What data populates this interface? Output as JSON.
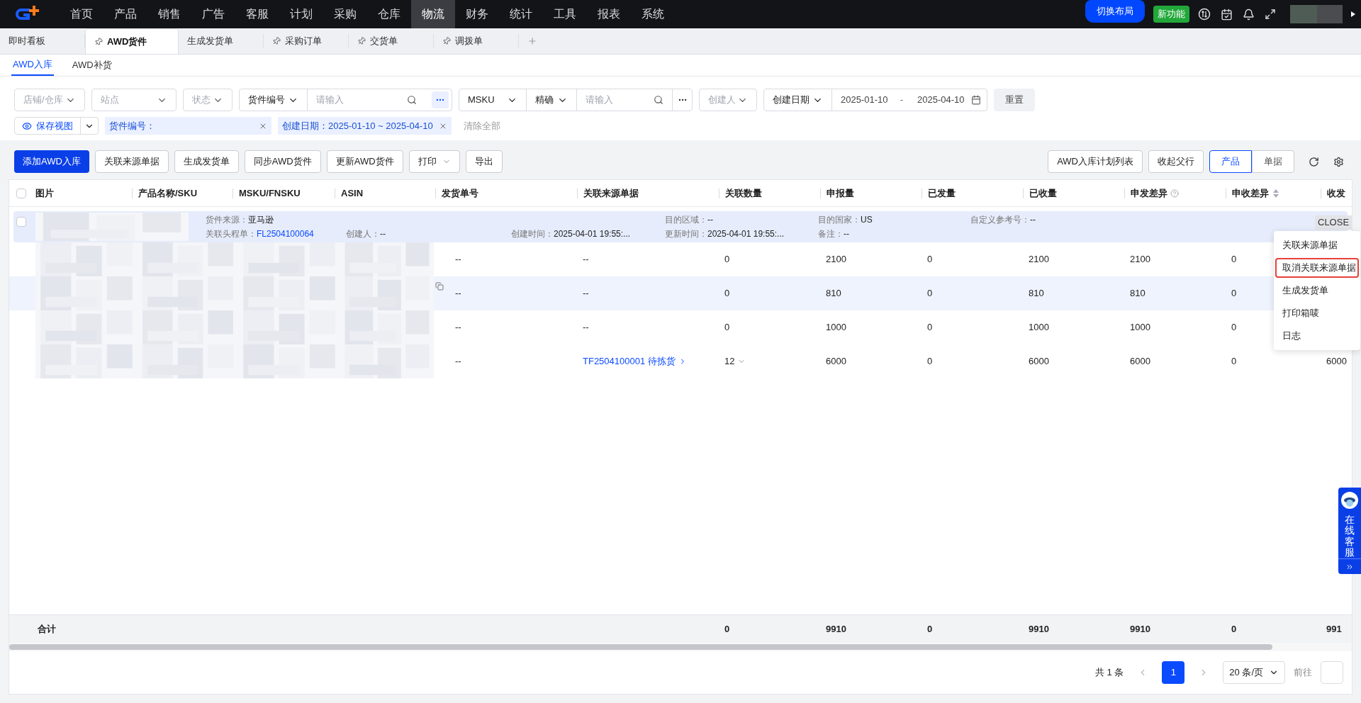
{
  "nav": {
    "items": [
      {
        "label": "首页",
        "selected": false
      },
      {
        "label": "产品",
        "selected": false
      },
      {
        "label": "销售",
        "selected": false
      },
      {
        "label": "广告",
        "selected": false
      },
      {
        "label": "客服",
        "selected": false
      },
      {
        "label": "计划",
        "selected": false
      },
      {
        "label": "采购",
        "selected": false
      },
      {
        "label": "仓库",
        "selected": false
      },
      {
        "label": "物流",
        "selected": true
      },
      {
        "label": "财务",
        "selected": false
      },
      {
        "label": "统计",
        "selected": false
      },
      {
        "label": "工具",
        "selected": false
      },
      {
        "label": "报表",
        "selected": false
      },
      {
        "label": "系统",
        "selected": false
      }
    ],
    "switch_layout": "切换布局",
    "new_feature": "新功能"
  },
  "page_tabs": [
    {
      "label": "即时看板",
      "pinned": false,
      "selected": false
    },
    {
      "label": "AWD货件",
      "pinned": true,
      "selected": true
    },
    {
      "label": "生成发货单",
      "pinned": false,
      "selected": false
    },
    {
      "label": "采购订单",
      "pinned": true,
      "selected": false
    },
    {
      "label": "交货单",
      "pinned": true,
      "selected": false
    },
    {
      "label": "调拨单",
      "pinned": true,
      "selected": false
    }
  ],
  "sub_tabs": [
    {
      "label": "AWD入库",
      "selected": true
    },
    {
      "label": "AWD补货",
      "selected": false
    }
  ],
  "filters": {
    "shop": {
      "placeholder": "店铺/仓库"
    },
    "site": {
      "placeholder": "站点"
    },
    "status": {
      "placeholder": "状态"
    },
    "shipment_no": {
      "field": "货件编号",
      "placeholder": "请输入"
    },
    "msku": {
      "field": "MSKU",
      "match": "精确",
      "placeholder": "请输入"
    },
    "creator": {
      "placeholder": "创建人"
    },
    "date": {
      "field": "创建日期",
      "start": "2025-01-10",
      "separator": "-",
      "end": "2025-04-10"
    },
    "reset": "重置"
  },
  "view": {
    "save_view": "保存视图",
    "tags": [
      {
        "label": "货件编号："
      },
      {
        "label": "创建日期：2025-01-10 ~ 2025-04-10"
      }
    ],
    "clear_all": "清除全部"
  },
  "toolbar": {
    "left": [
      {
        "label": "添加AWD入库",
        "kind": "primary"
      },
      {
        "label": "关联来源单据",
        "kind": "default"
      },
      {
        "label": "生成发货单",
        "kind": "default"
      },
      {
        "label": "同步AWD货件",
        "kind": "default"
      },
      {
        "label": "更新AWD货件",
        "kind": "default"
      },
      {
        "label": "打印",
        "kind": "dropdown"
      },
      {
        "label": "导出",
        "kind": "default"
      }
    ],
    "right": [
      {
        "label": "AWD入库计划列表"
      },
      {
        "label": "收起父行"
      }
    ],
    "view_toggle": [
      {
        "label": "产品",
        "selected": true
      },
      {
        "label": "单据",
        "selected": false
      }
    ]
  },
  "table": {
    "all_checked": false,
    "columns": [
      {
        "label": "图片",
        "kind": "text"
      },
      {
        "label": "产品名称/SKU",
        "kind": "text"
      },
      {
        "label": "MSKU/FNSKU",
        "kind": "text"
      },
      {
        "label": "ASIN",
        "kind": "text"
      },
      {
        "label": "发货单号",
        "kind": "text"
      },
      {
        "label": "关联来源单据",
        "kind": "text"
      },
      {
        "label": "关联数量",
        "kind": "text"
      },
      {
        "label": "申报量",
        "kind": "text"
      },
      {
        "label": "已发量",
        "kind": "text"
      },
      {
        "label": "已收量",
        "kind": "text"
      },
      {
        "label": "申发差异",
        "kind": "help"
      },
      {
        "label": "申收差异",
        "kind": "sort"
      },
      {
        "label": "收发",
        "kind": "text"
      }
    ],
    "group": {
      "checked": false,
      "line_1": [
        {
          "label": "货件来源：",
          "value": "亚马逊",
          "kind": "text"
        },
        {
          "label": "目的区域：",
          "value": "--",
          "kind": "text"
        },
        {
          "label": "目的国家：",
          "value": "US",
          "kind": "text"
        },
        {
          "label": "自定义参考号：",
          "value": "--",
          "kind": "text"
        }
      ],
      "line_2": [
        {
          "label": "关联头程单：",
          "value": "FL2504100064",
          "kind": "link"
        },
        {
          "label": "创建人：",
          "value": "--",
          "kind": "text"
        },
        {
          "label": "创建时间：",
          "value": "2025-04-01 19:55:...",
          "kind": "text"
        },
        {
          "label": "更新时间：",
          "value": "2025-04-01 19:55:...",
          "kind": "text"
        },
        {
          "label": "备注：",
          "value": "--",
          "kind": "text"
        }
      ],
      "status": "CLOSE"
    },
    "rows": [
      {
        "highlighted": false,
        "copy": false,
        "cells": [
          {
            "kind": "picture"
          },
          {
            "kind": "picture"
          },
          {
            "kind": "picture"
          },
          {
            "kind": "picture"
          },
          {
            "kind": "text",
            "text": "--"
          },
          {
            "kind": "text",
            "text": "--"
          },
          {
            "kind": "text",
            "text": "0"
          },
          {
            "kind": "text",
            "text": "2100"
          },
          {
            "kind": "text",
            "text": "0"
          },
          {
            "kind": "text",
            "text": "2100"
          },
          {
            "kind": "text",
            "text": "2100"
          },
          {
            "kind": "text",
            "text": "0"
          }
        ]
      },
      {
        "highlighted": true,
        "copy": true,
        "cells": [
          {
            "kind": "picture"
          },
          {
            "kind": "picture"
          },
          {
            "kind": "picture"
          },
          {
            "kind": "picture"
          },
          {
            "kind": "text",
            "text": "--"
          },
          {
            "kind": "text",
            "text": "--"
          },
          {
            "kind": "text",
            "text": "0"
          },
          {
            "kind": "text",
            "text": "810"
          },
          {
            "kind": "text",
            "text": "0"
          },
          {
            "kind": "text",
            "text": "810"
          },
          {
            "kind": "text",
            "text": "810"
          },
          {
            "kind": "text",
            "text": "0"
          }
        ]
      },
      {
        "highlighted": false,
        "copy": false,
        "cells": [
          {
            "kind": "picture"
          },
          {
            "kind": "picture"
          },
          {
            "kind": "picture"
          },
          {
            "kind": "picture"
          },
          {
            "kind": "text",
            "text": "--"
          },
          {
            "kind": "text",
            "text": "--"
          },
          {
            "kind": "text",
            "text": "0"
          },
          {
            "kind": "text",
            "text": "1000"
          },
          {
            "kind": "text",
            "text": "0"
          },
          {
            "kind": "text",
            "text": "1000"
          },
          {
            "kind": "text",
            "text": "1000"
          },
          {
            "kind": "text",
            "text": "0"
          }
        ]
      },
      {
        "highlighted": false,
        "copy": false,
        "cells": [
          {
            "kind": "picture"
          },
          {
            "kind": "picture"
          },
          {
            "kind": "picture"
          },
          {
            "kind": "picture"
          },
          {
            "kind": "text",
            "text": "--"
          },
          {
            "kind": "link",
            "text": "TF2504100001 待拣货"
          },
          {
            "kind": "expandable",
            "text": "12"
          },
          {
            "kind": "text",
            "text": "6000"
          },
          {
            "kind": "text",
            "text": "0"
          },
          {
            "kind": "text",
            "text": "6000"
          },
          {
            "kind": "text",
            "text": "6000"
          },
          {
            "kind": "text",
            "text": "0"
          },
          {
            "kind": "text",
            "text": "6000"
          }
        ]
      }
    ],
    "totals": {
      "label": "合计",
      "values": [
        "0",
        "9910",
        "0",
        "9910",
        "9910",
        "0",
        "991"
      ]
    }
  },
  "context_menu": [
    {
      "label": "关联来源单据",
      "highlighted": false
    },
    {
      "label": "取消关联来源单据",
      "highlighted": true
    },
    {
      "label": "生成发货单",
      "highlighted": false
    },
    {
      "label": "打印箱唛",
      "highlighted": false
    },
    {
      "label": "日志",
      "highlighted": false
    }
  ],
  "pagination": {
    "total": "共 1 条",
    "pages": [
      {
        "label": "1",
        "selected": true
      }
    ],
    "page_size": "20 条/页",
    "goto": "前往"
  },
  "support": {
    "label": "在线客服"
  }
}
